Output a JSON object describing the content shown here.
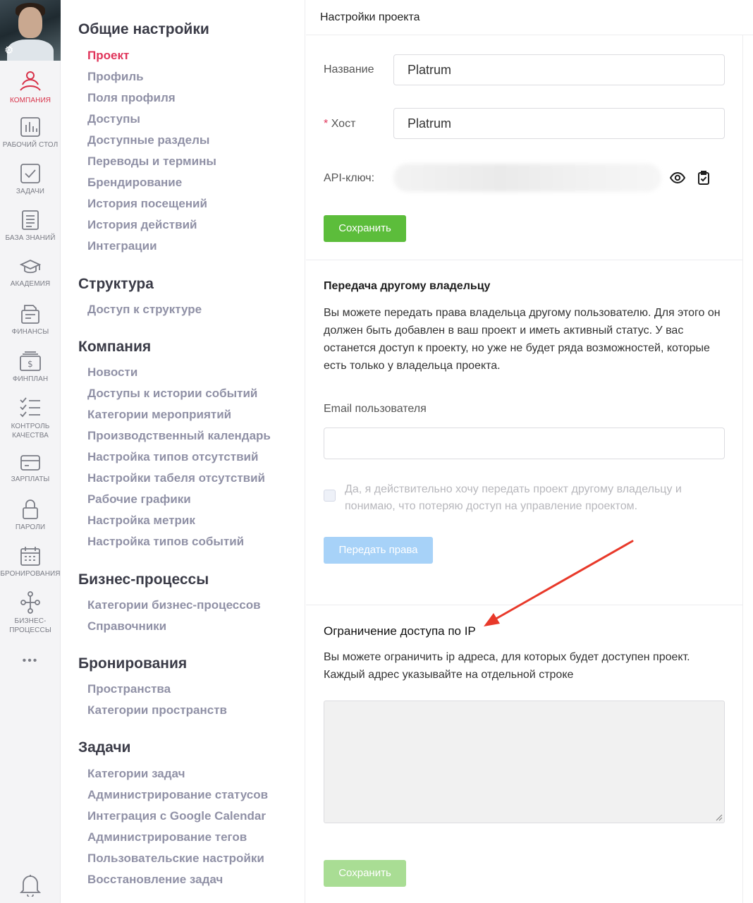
{
  "rail": {
    "items": [
      {
        "label": "КОМПАНИЯ",
        "icon": "company-icon"
      },
      {
        "label": "РАБОЧИЙ СТОЛ",
        "icon": "dashboard-icon"
      },
      {
        "label": "ЗАДАЧИ",
        "icon": "tasks-icon"
      },
      {
        "label": "БАЗА ЗНАНИЙ",
        "icon": "knowledge-base-icon"
      },
      {
        "label": "АКАДЕМИЯ",
        "icon": "academy-icon"
      },
      {
        "label": "ФИНАНСЫ",
        "icon": "finance-icon"
      },
      {
        "label": "ФИНПЛАН",
        "icon": "finplan-icon"
      },
      {
        "label": "КОНТРОЛЬ КАЧЕСТВА",
        "icon": "quality-control-icon"
      },
      {
        "label": "ЗАРПЛАТЫ",
        "icon": "salary-icon"
      },
      {
        "label": "ПАРОЛИ",
        "icon": "passwords-icon"
      },
      {
        "label": "БРОНИРОВАНИЯ",
        "icon": "booking-icon"
      },
      {
        "label": "БИЗНЕС-ПРОЦЕССЫ",
        "icon": "business-process-icon"
      }
    ],
    "more": "•••",
    "active_color": "#d8334a"
  },
  "menu": {
    "sections": [
      {
        "title": "Общие настройки",
        "items": [
          "Проект",
          "Профиль",
          "Поля профиля",
          "Доступы",
          "Доступные разделы",
          "Переводы и термины",
          "Брендирование",
          "История посещений",
          "История действий",
          "Интеграции"
        ]
      },
      {
        "title": "Структура",
        "items": [
          "Доступ к структуре"
        ]
      },
      {
        "title": "Компания",
        "items": [
          "Новости",
          "Доступы к истории событий",
          "Категории мероприятий",
          "Производственный календарь",
          "Настройка типов отсутствий",
          "Настройки табеля отсутствий",
          "Рабочие графики",
          "Настройка метрик",
          "Настройка типов событий"
        ]
      },
      {
        "title": "Бизнес-процессы",
        "items": [
          "Категории бизнес-процессов",
          "Справочники"
        ]
      },
      {
        "title": "Бронирования",
        "items": [
          "Пространства",
          "Категории пространств"
        ]
      },
      {
        "title": "Задачи",
        "items": [
          "Категории задач",
          "Администрирование статусов",
          "Интеграция с Google Calendar",
          "Администрирование тегов",
          "Пользовательские настройки",
          "Восстановление задач"
        ]
      }
    ],
    "active_item": "Проект",
    "active_color": "#e0345a"
  },
  "header": {
    "title": "Настройки проекта"
  },
  "project_form": {
    "name_label": "Название",
    "name_value": "Platrum",
    "host_required_mark": "*",
    "host_label": "Хост",
    "host_value": "Platrum",
    "api_key_label": "API-ключ:",
    "show_icon": "eye-icon",
    "copy_icon": "clipboard-icon",
    "save_label": "Сохранить"
  },
  "transfer": {
    "title": "Передача другому владельцу",
    "description": "Вы можете передать права владельца другому пользователю. Для этого он должен быть добавлен в ваш проект и иметь активный статус. У вас останется доступ к проекту, но уже не будет ряда возможностей, которые есть только у владельца проекта.",
    "email_label": "Email пользователя",
    "email_value": "",
    "confirm_label": "Да, я действительно хочу передать проект другому владельцу и понимаю, что потеряю доступ на управление проектом.",
    "confirm_checked": false,
    "submit_label": "Передать права"
  },
  "ip_restriction": {
    "title": "Ограничение доступа по IP",
    "description": "Вы можете ограничить ip адреса, для которых будет доступен проект. Каждый адрес указывайте на отдельной строке",
    "textarea_value": "",
    "save_label": "Сохранить"
  },
  "colors": {
    "primary_green": "#5cbd3b",
    "disabled_blue": "#a7d2f8",
    "annotation_arrow": "#e8392a"
  }
}
